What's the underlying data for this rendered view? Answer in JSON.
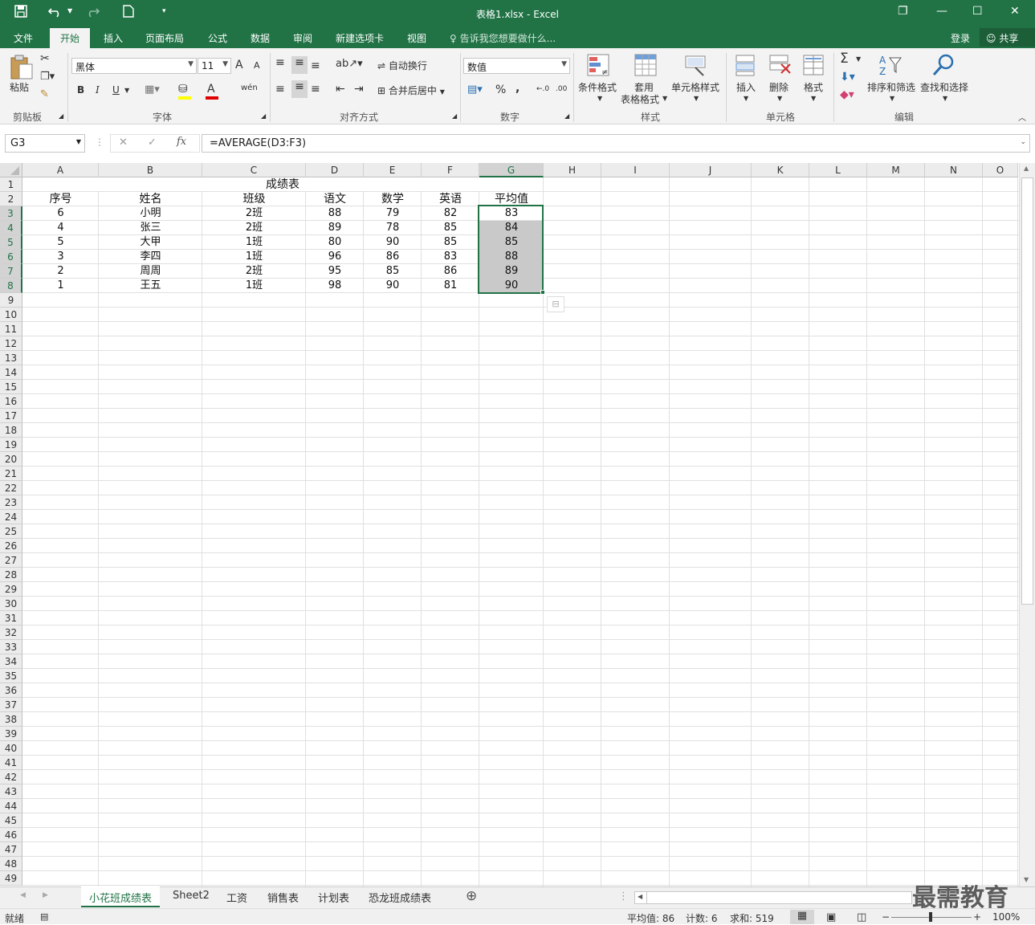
{
  "window": {
    "title": "表格1.xlsx - Excel",
    "save_icon": "save-icon",
    "undo_icon": "undo-icon",
    "redo_icon": "redo-icon",
    "new_icon": "new-file-icon",
    "restore_glyph": "❐",
    "minimize_glyph": "—",
    "maximize_glyph": "☐",
    "close_glyph": "✕"
  },
  "menu": {
    "tabs": [
      "文件",
      "开始",
      "插入",
      "页面布局",
      "公式",
      "数据",
      "审阅",
      "新建选项卡",
      "视图"
    ],
    "active_tab": "开始",
    "tell_me": "告诉我您想要做什么...",
    "login": "登录",
    "share": "共享"
  },
  "ribbon": {
    "clipboard": {
      "paste": "粘贴",
      "label": "剪贴板"
    },
    "font": {
      "name": "黑体",
      "size": "11",
      "label": "字体",
      "bold": "B",
      "italic": "I",
      "underline": "U",
      "grow": "A",
      "shrink": "A",
      "font_color_letter": "A",
      "phonetic": "wén"
    },
    "alignment": {
      "wrap": "自动换行",
      "merge": "合并后居中",
      "label": "对齐方式"
    },
    "number": {
      "format": "数值",
      "percent": "%",
      "comma": ",",
      "label": "数字"
    },
    "styles": {
      "conditional": "条件格式",
      "table_line1": "套用",
      "table_line2": "表格格式",
      "cell_styles": "单元格样式",
      "label": "样式"
    },
    "cells": {
      "insert": "插入",
      "delete": "删除",
      "format": "格式",
      "label": "单元格"
    },
    "editing": {
      "sort": "排序和筛选",
      "find": "查找和选择",
      "sum": "Σ",
      "label": "编辑"
    }
  },
  "formula_bar": {
    "name_box": "G3",
    "cancel": "✕",
    "confirm": "✓",
    "fx": "fx",
    "formula": "=AVERAGE(D3:F3)"
  },
  "columns": [
    "A",
    "B",
    "C",
    "D",
    "E",
    "F",
    "G",
    "H",
    "I",
    "J",
    "K",
    "L",
    "M",
    "N",
    "O"
  ],
  "selected_column": "G",
  "selected_rows": [
    3,
    4,
    5,
    6,
    7,
    8
  ],
  "sheet": {
    "title": "成绩表",
    "headers": [
      "序号",
      "姓名",
      "班级",
      "语文",
      "数学",
      "英语",
      "平均值"
    ],
    "rows": [
      [
        "6",
        "小明",
        "2班",
        "88",
        "79",
        "82",
        "83"
      ],
      [
        "4",
        "张三",
        "2班",
        "89",
        "78",
        "85",
        "84"
      ],
      [
        "5",
        "大甲",
        "1班",
        "80",
        "90",
        "85",
        "85"
      ],
      [
        "3",
        "李四",
        "1班",
        "96",
        "86",
        "83",
        "88"
      ],
      [
        "2",
        "周周",
        "2班",
        "95",
        "85",
        "86",
        "89"
      ],
      [
        "1",
        "王五",
        "1班",
        "98",
        "90",
        "81",
        "90"
      ]
    ]
  },
  "row_count": 49,
  "sheet_tabs": [
    "小花班成绩表",
    "Sheet2",
    "工资",
    "销售表",
    "计划表",
    "恐龙班成绩表"
  ],
  "active_sheet": "小花班成绩表",
  "add_sheet_glyph": "⊕",
  "status": {
    "ready": "就绪",
    "average": "平均值: 86",
    "count": "计数: 6",
    "sum": "求和: 519",
    "zoom": "100%"
  },
  "watermark": "最需教育",
  "colors": {
    "accent": "#217346",
    "selection": "#c9c9c9"
  }
}
